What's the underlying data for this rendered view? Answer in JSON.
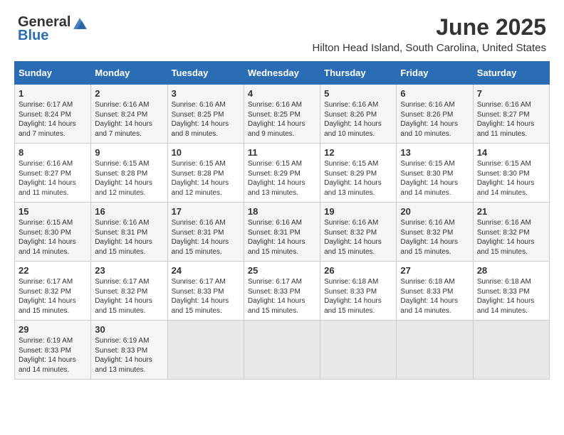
{
  "logo": {
    "general": "General",
    "blue": "Blue"
  },
  "title": "June 2025",
  "location": "Hilton Head Island, South Carolina, United States",
  "days_of_week": [
    "Sunday",
    "Monday",
    "Tuesday",
    "Wednesday",
    "Thursday",
    "Friday",
    "Saturday"
  ],
  "weeks": [
    [
      {
        "day": "1",
        "sunrise": "6:17 AM",
        "sunset": "8:24 PM",
        "daylight": "14 hours and 7 minutes."
      },
      {
        "day": "2",
        "sunrise": "6:16 AM",
        "sunset": "8:24 PM",
        "daylight": "14 hours and 7 minutes."
      },
      {
        "day": "3",
        "sunrise": "6:16 AM",
        "sunset": "8:25 PM",
        "daylight": "14 hours and 8 minutes."
      },
      {
        "day": "4",
        "sunrise": "6:16 AM",
        "sunset": "8:25 PM",
        "daylight": "14 hours and 9 minutes."
      },
      {
        "day": "5",
        "sunrise": "6:16 AM",
        "sunset": "8:26 PM",
        "daylight": "14 hours and 10 minutes."
      },
      {
        "day": "6",
        "sunrise": "6:16 AM",
        "sunset": "8:26 PM",
        "daylight": "14 hours and 10 minutes."
      },
      {
        "day": "7",
        "sunrise": "6:16 AM",
        "sunset": "8:27 PM",
        "daylight": "14 hours and 11 minutes."
      }
    ],
    [
      {
        "day": "8",
        "sunrise": "6:16 AM",
        "sunset": "8:27 PM",
        "daylight": "14 hours and 11 minutes."
      },
      {
        "day": "9",
        "sunrise": "6:15 AM",
        "sunset": "8:28 PM",
        "daylight": "14 hours and 12 minutes."
      },
      {
        "day": "10",
        "sunrise": "6:15 AM",
        "sunset": "8:28 PM",
        "daylight": "14 hours and 12 minutes."
      },
      {
        "day": "11",
        "sunrise": "6:15 AM",
        "sunset": "8:29 PM",
        "daylight": "14 hours and 13 minutes."
      },
      {
        "day": "12",
        "sunrise": "6:15 AM",
        "sunset": "8:29 PM",
        "daylight": "14 hours and 13 minutes."
      },
      {
        "day": "13",
        "sunrise": "6:15 AM",
        "sunset": "8:30 PM",
        "daylight": "14 hours and 14 minutes."
      },
      {
        "day": "14",
        "sunrise": "6:15 AM",
        "sunset": "8:30 PM",
        "daylight": "14 hours and 14 minutes."
      }
    ],
    [
      {
        "day": "15",
        "sunrise": "6:15 AM",
        "sunset": "8:30 PM",
        "daylight": "14 hours and 14 minutes."
      },
      {
        "day": "16",
        "sunrise": "6:16 AM",
        "sunset": "8:31 PM",
        "daylight": "14 hours and 15 minutes."
      },
      {
        "day": "17",
        "sunrise": "6:16 AM",
        "sunset": "8:31 PM",
        "daylight": "14 hours and 15 minutes."
      },
      {
        "day": "18",
        "sunrise": "6:16 AM",
        "sunset": "8:31 PM",
        "daylight": "14 hours and 15 minutes."
      },
      {
        "day": "19",
        "sunrise": "6:16 AM",
        "sunset": "8:32 PM",
        "daylight": "14 hours and 15 minutes."
      },
      {
        "day": "20",
        "sunrise": "6:16 AM",
        "sunset": "8:32 PM",
        "daylight": "14 hours and 15 minutes."
      },
      {
        "day": "21",
        "sunrise": "6:16 AM",
        "sunset": "8:32 PM",
        "daylight": "14 hours and 15 minutes."
      }
    ],
    [
      {
        "day": "22",
        "sunrise": "6:17 AM",
        "sunset": "8:32 PM",
        "daylight": "14 hours and 15 minutes."
      },
      {
        "day": "23",
        "sunrise": "6:17 AM",
        "sunset": "8:32 PM",
        "daylight": "14 hours and 15 minutes."
      },
      {
        "day": "24",
        "sunrise": "6:17 AM",
        "sunset": "8:33 PM",
        "daylight": "14 hours and 15 minutes."
      },
      {
        "day": "25",
        "sunrise": "6:17 AM",
        "sunset": "8:33 PM",
        "daylight": "14 hours and 15 minutes."
      },
      {
        "day": "26",
        "sunrise": "6:18 AM",
        "sunset": "8:33 PM",
        "daylight": "14 hours and 15 minutes."
      },
      {
        "day": "27",
        "sunrise": "6:18 AM",
        "sunset": "8:33 PM",
        "daylight": "14 hours and 14 minutes."
      },
      {
        "day": "28",
        "sunrise": "6:18 AM",
        "sunset": "8:33 PM",
        "daylight": "14 hours and 14 minutes."
      }
    ],
    [
      {
        "day": "29",
        "sunrise": "6:19 AM",
        "sunset": "8:33 PM",
        "daylight": "14 hours and 14 minutes."
      },
      {
        "day": "30",
        "sunrise": "6:19 AM",
        "sunset": "8:33 PM",
        "daylight": "14 hours and 13 minutes."
      },
      null,
      null,
      null,
      null,
      null
    ]
  ],
  "labels": {
    "sunrise_prefix": "Sunrise: ",
    "sunset_prefix": "Sunset: ",
    "daylight_prefix": "Daylight: "
  }
}
